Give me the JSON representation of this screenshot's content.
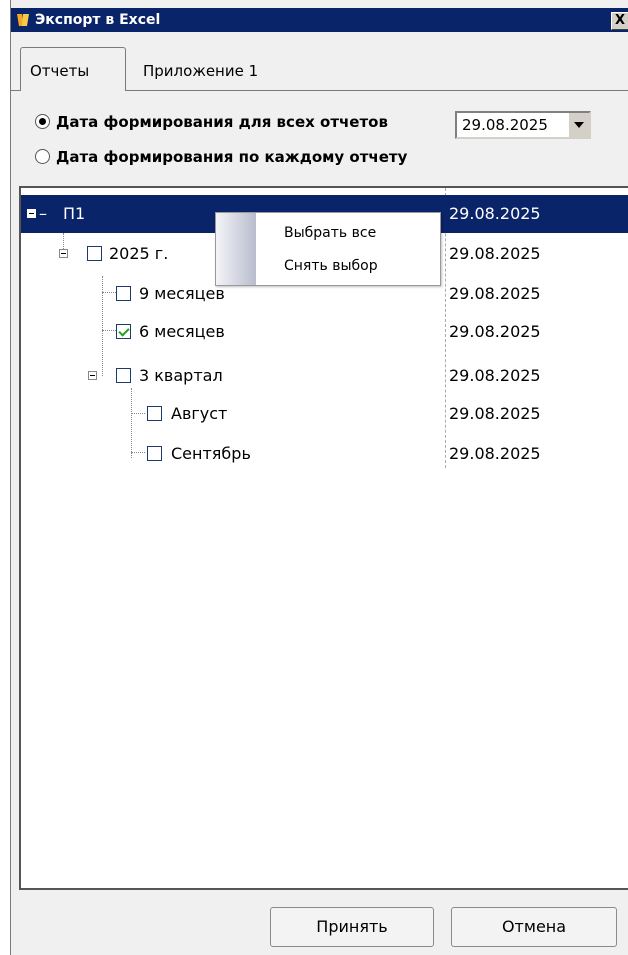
{
  "window": {
    "title": "Экспорт в Excel",
    "close_label": "X"
  },
  "tabs": [
    {
      "label": "Отчеты",
      "active": true
    },
    {
      "label": "Приложение 1",
      "active": false
    }
  ],
  "options": {
    "all_reports_date_label": "Дата формирования для всех отчетов",
    "per_report_date_label": "Дата формирования по каждому отчету",
    "selected": "all_reports_date",
    "date_value": "29.08.2025"
  },
  "tree": {
    "rows": [
      {
        "label": "П1",
        "date": "29.08.2025",
        "selected": true
      },
      {
        "label": "2025 г.",
        "date": "29.08.2025",
        "checked": false
      },
      {
        "label": "9 месяцев",
        "date": "29.08.2025",
        "checked": false
      },
      {
        "label": "6 месяцев",
        "date": "29.08.2025",
        "checked": true
      },
      {
        "label": "3 квартал",
        "date": "29.08.2025",
        "checked": false
      },
      {
        "label": "Август",
        "date": "29.08.2025",
        "checked": false
      },
      {
        "label": "Сентябрь",
        "date": "29.08.2025",
        "checked": false
      }
    ]
  },
  "context_menu": {
    "items": [
      "Выбрать все",
      "Снять выбор"
    ]
  },
  "buttons": {
    "accept": "Принять",
    "cancel": "Отмена"
  },
  "colors": {
    "title_bar": "#0a246a",
    "selection": "#0a246a"
  }
}
